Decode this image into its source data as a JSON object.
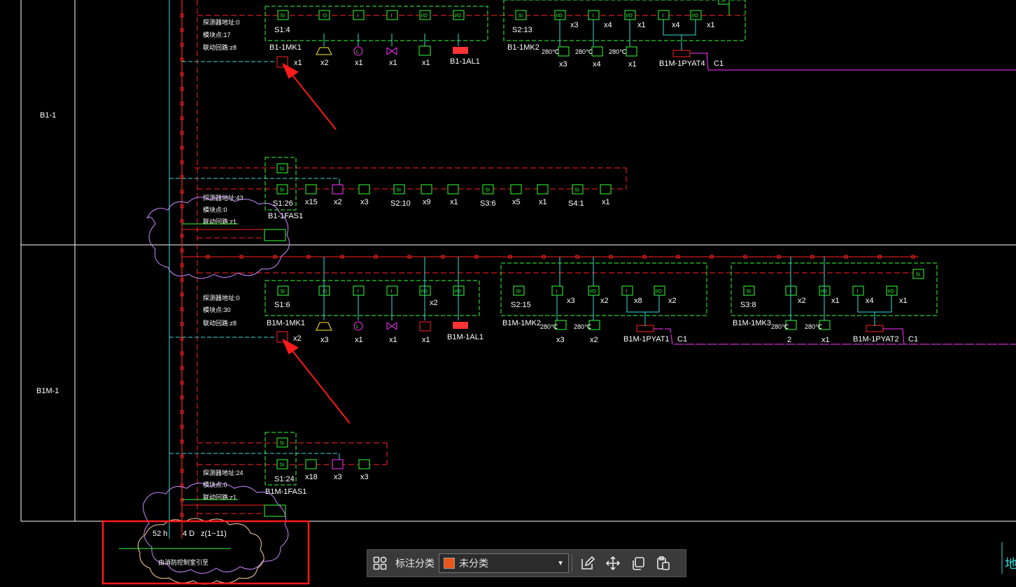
{
  "floors": [
    {
      "label": "B1-1"
    },
    {
      "label": "B1M-1"
    }
  ],
  "b1": {
    "info1": [
      "探测器地址:0",
      "模块点:17",
      "联动回路:z8"
    ],
    "info2": [
      "探测器地址:43",
      "模块点:0",
      "联动回路:z1"
    ],
    "mk1_s": "S1:4",
    "mk1_name": "B1-1MK1",
    "mk2_s": "S2:13",
    "mk2_name": "B1-1MK2",
    "al1": "B1-1AL1",
    "pyat": "B1M-1PYAT4",
    "pyat_c": "C1",
    "row1_counts": [
      "x1",
      "x2",
      "x1",
      "x1",
      "x1"
    ],
    "mk2_counts": [
      "x3",
      "x4",
      "x1",
      "x4",
      "x1"
    ],
    "temp_counts": [
      "x3",
      "x4",
      "x1"
    ],
    "fas_s": "S1:26",
    "fas_name": "B1-1FAS1",
    "fas_counts": [
      "x15",
      "x2",
      "x3",
      "S2:10",
      "x9",
      "x1",
      "S3:6",
      "x5",
      "x1",
      "S4:1",
      "x1"
    ]
  },
  "b1m": {
    "info1": [
      "探测器地址:0",
      "模块点:30",
      "联动回路:z8"
    ],
    "info2": [
      "探测器地址:24",
      "模块点:0",
      "联动回路:z1"
    ],
    "mk1_s": "S1:6",
    "mk1_name": "B1M-1MK1",
    "mk2_s": "S2:15",
    "mk2_name": "B1M-1MK2",
    "mk3_s": "S3:8",
    "mk3_name": "B1M-1MK3",
    "al1": "B1M-1AL1",
    "pyat1": "B1M-1PYAT1",
    "pyat2": "B1M-1PYAT2",
    "pyat_c": "C1",
    "row1_counts": [
      "x2",
      "x3",
      "x1",
      "x1",
      "x1",
      "x2"
    ],
    "mk2_counts": [
      "x3",
      "x2",
      "x8",
      "x2"
    ],
    "mk2_temp": [
      "x3",
      "x2"
    ],
    "mk3_counts": [
      "x2",
      "x1",
      "x4",
      "x1"
    ],
    "mk3_temp": [
      "2",
      "x1"
    ],
    "fas_s": "S1:24",
    "fas_name": "B1M-1FAS1",
    "fas_counts": [
      "x18",
      "x3",
      "x3"
    ]
  },
  "bottom": {
    "cable1": "52 h",
    "cable2": "4 D",
    "cable3": "z(1~11)",
    "note": "由消防控制室引至",
    "right_char": "地"
  },
  "temp_label": "280℃",
  "box_labels": {
    "si": "SI",
    "io": "I/O",
    "i": "I",
    "o": "O",
    "l": "L"
  },
  "toolbar": {
    "label": "标注分类",
    "selected": "未分类",
    "swatch_color": "#e8561b"
  },
  "colors": {
    "red": "#ff2222",
    "green": "#33ff33",
    "cyan": "#33dddd",
    "magenta": "#ff33ff",
    "cloud": "#cc88ff",
    "highlight": "#ff1a1a",
    "yellow": "#ffee33"
  }
}
